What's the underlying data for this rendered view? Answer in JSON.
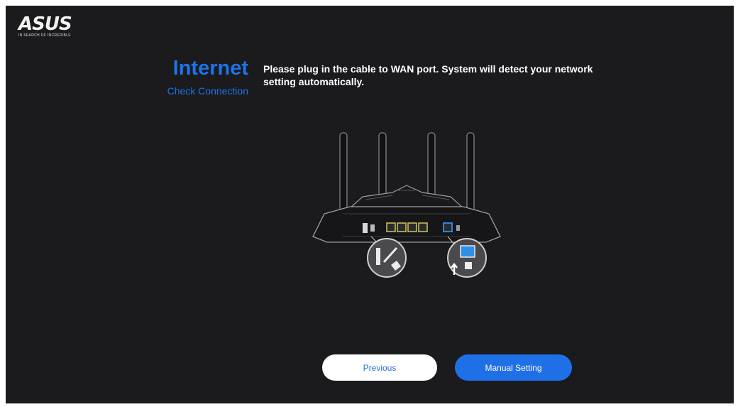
{
  "brand": {
    "logo_text": "ASUS",
    "logo_tagline": "IN SEARCH OF INCREDIBLE"
  },
  "header": {
    "title": "Internet",
    "subtitle": "Check Connection"
  },
  "instruction": "Please plug in the cable to WAN port. System will detect your network setting automatically.",
  "illustration": {
    "icons": [
      "router-icon",
      "power-plug-icon",
      "wan-port-arrow-icon"
    ]
  },
  "buttons": {
    "previous": "Previous",
    "manual_setting": "Manual Setting"
  },
  "colors": {
    "background": "#1b1b1d",
    "accent": "#1e73e8",
    "text": "#ffffff"
  }
}
